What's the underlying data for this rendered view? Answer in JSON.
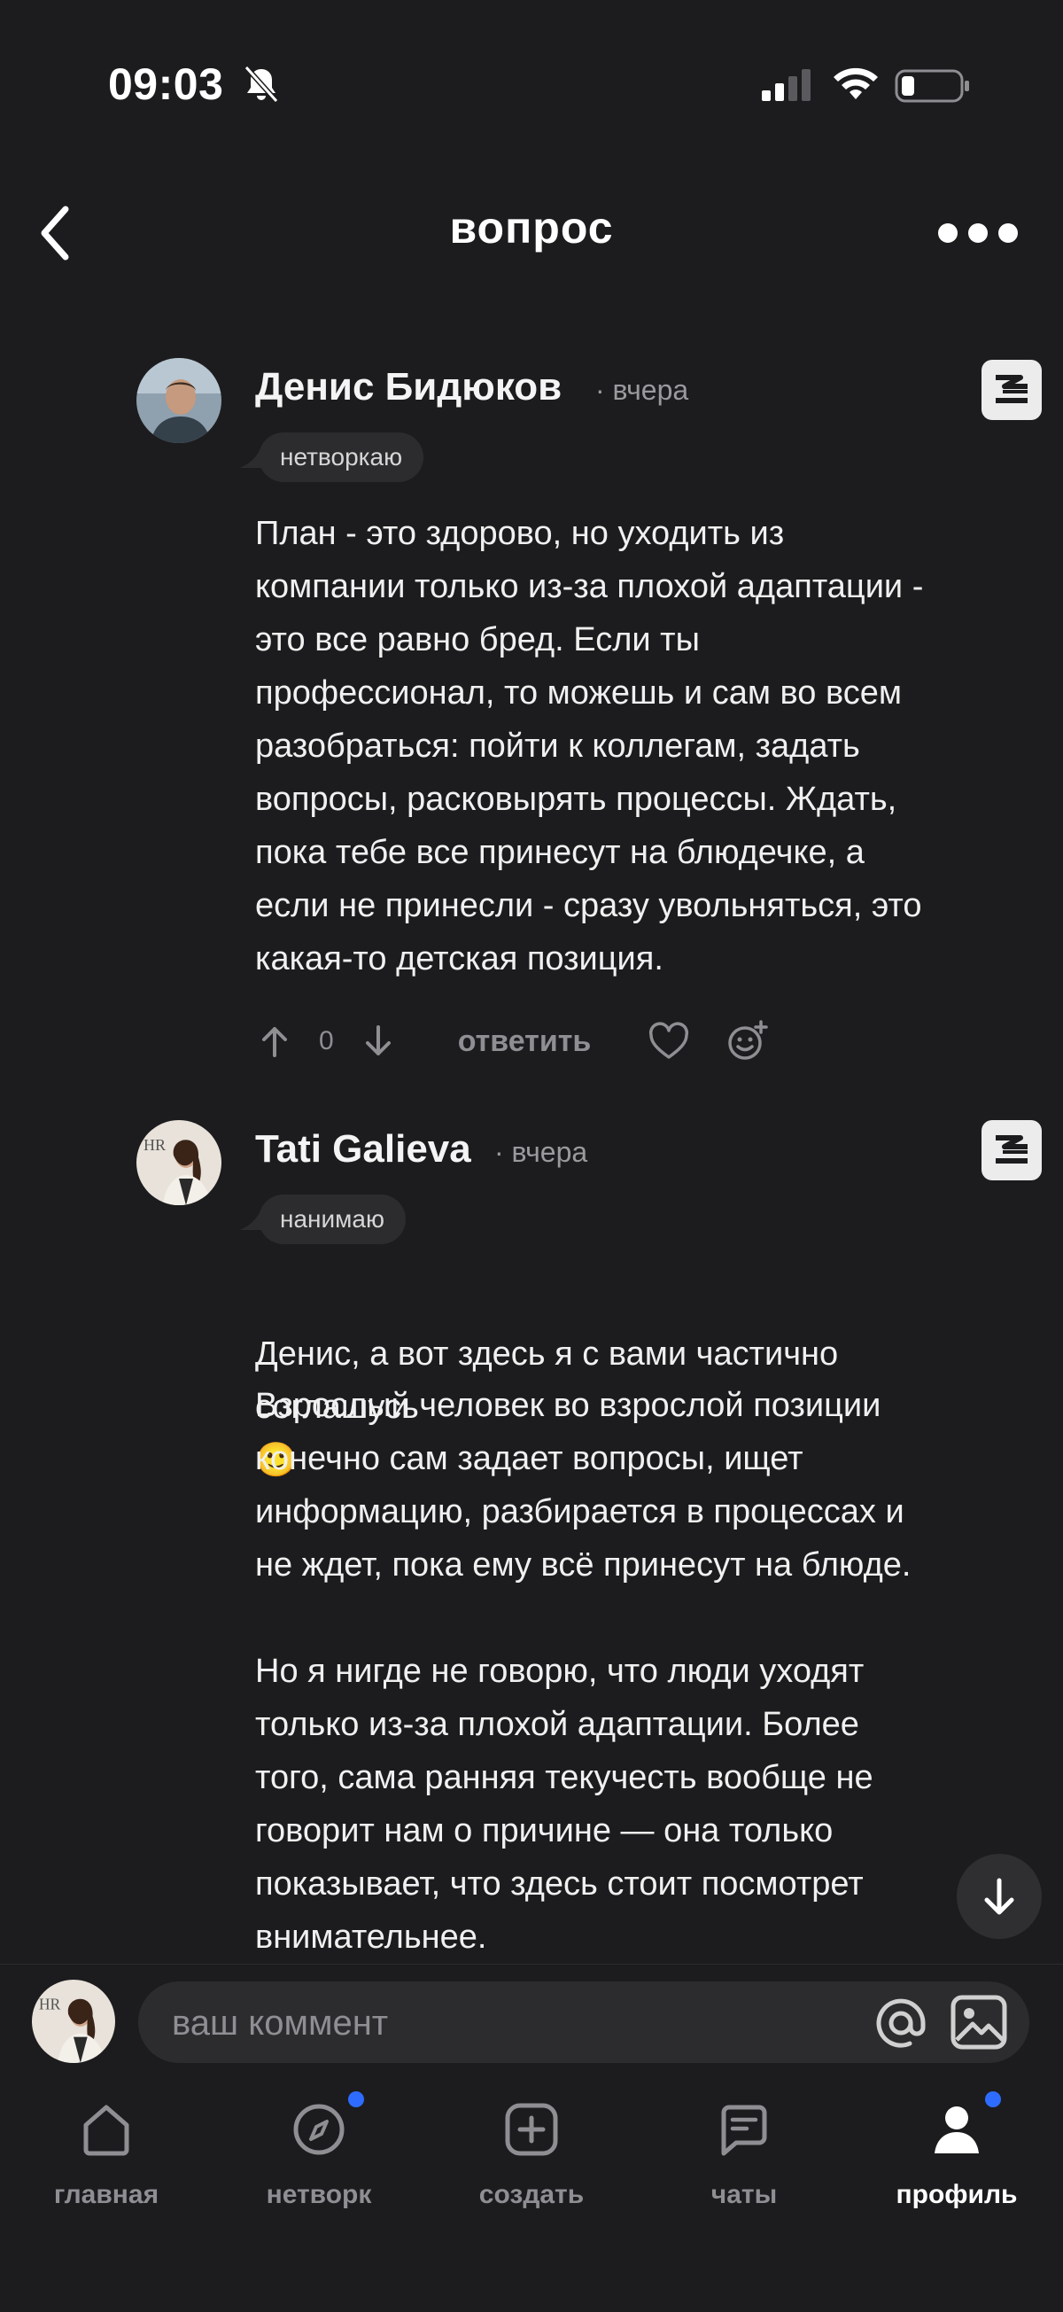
{
  "status": {
    "time": "09:03"
  },
  "header": {
    "title": "вопрос"
  },
  "comments": [
    {
      "author": "Денис Бидюков",
      "time": "· вчера",
      "tag": "нетворкаю",
      "text": "План - это здорово, но уходить из\nкомпании только из-за плохой адаптации -\nэто все равно бред. Если ты\nпрофессионал, то можешь и сам во всем\nразобраться: пойти к коллегам, задать\nвопросы, расковырять процессы. Ждать,\nпока тебе все принесут на блюдечке, а\nесли не принесли - сразу увольняться, это\nкакая-то детская позиция.",
      "votes": "0",
      "reply_label": "ответить"
    },
    {
      "author": "Tati Galieva",
      "time": "· вчера",
      "tag": "нанимаю",
      "text_p1": "Денис, а вот здесь я с вами частично\nсоглашусь",
      "emoji": "🙂",
      "text_p2": "Взрослый человек во взрослой позиции\nконечно сам задает вопросы, ищет\nинформацию, разбирается в процессах и\nне ждет, пока ему всё принесут на блюде.",
      "text_p3": "Но я нигде не говорю, что люди уходят\nтолько из-за плохой адаптации. Более\nтого, сама ранняя текучесть вообще не\nговорит нам о причине — она только\nпоказывает, что здесь стоит посмотрет\nвнимательнее."
    }
  ],
  "comment_input": {
    "placeholder": "ваш коммент"
  },
  "avatar_text": "HR",
  "tabs": [
    {
      "label": "главная",
      "icon": "home-icon"
    },
    {
      "label": "нетворк",
      "icon": "compass-icon"
    },
    {
      "label": "создать",
      "icon": "plus-square-icon"
    },
    {
      "label": "чаты",
      "icon": "chat-icon"
    },
    {
      "label": "профиль",
      "icon": "profile-icon"
    }
  ],
  "colors": {
    "background": "#1c1c1e",
    "pill": "#2c2c2e",
    "muted": "#8e8e93",
    "notification_dot": "#2e6cff"
  }
}
